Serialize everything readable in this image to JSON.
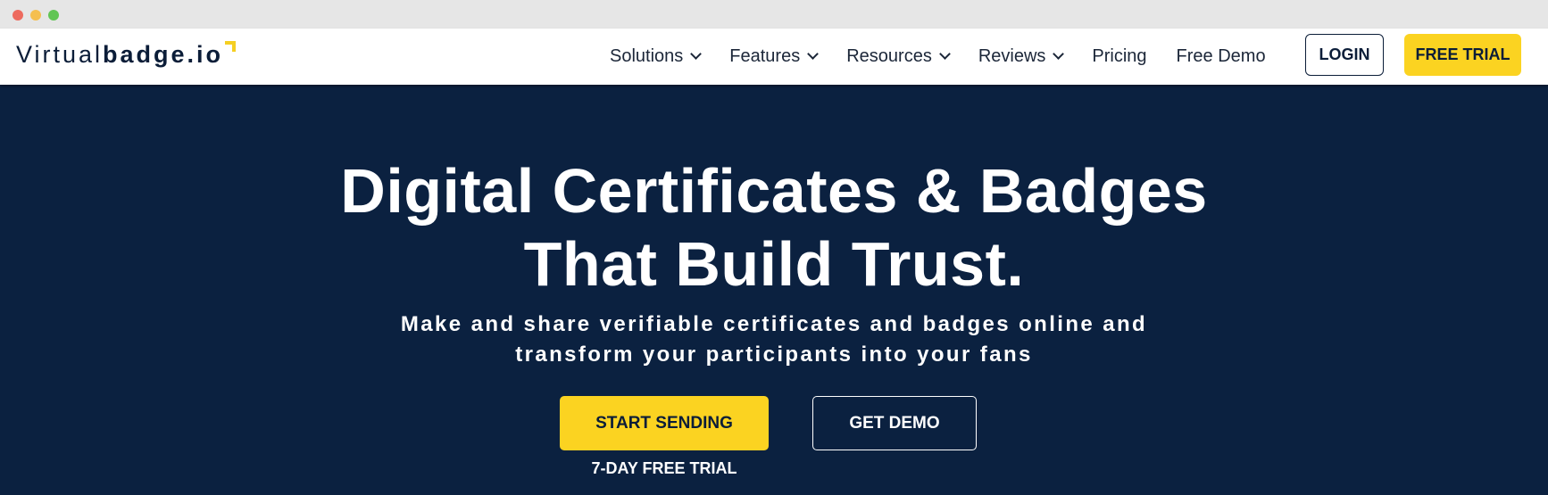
{
  "logo": {
    "light": "Virtual",
    "bold": "badge.io"
  },
  "nav": {
    "items": [
      {
        "label": "Solutions",
        "dropdown": true
      },
      {
        "label": "Features",
        "dropdown": true
      },
      {
        "label": "Resources",
        "dropdown": true
      },
      {
        "label": "Reviews",
        "dropdown": true
      },
      {
        "label": "Pricing",
        "dropdown": false
      },
      {
        "label": "Free Demo",
        "dropdown": false
      }
    ],
    "login_label": "LOGIN",
    "trial_label": "FREE TRIAL"
  },
  "hero": {
    "title_line1": "Digital Certificates & Badges",
    "title_line2": "That Build Trust.",
    "subtitle_line1": "Make and share verifiable certificates and badges online and",
    "subtitle_line2": "transform your participants into your fans",
    "primary_cta": "START SENDING",
    "secondary_cta": "GET DEMO",
    "trial_note": "7-DAY FREE TRIAL"
  },
  "colors": {
    "hero_bg": "#0b2140",
    "accent": "#fbd321",
    "navy": "#0b1d38"
  }
}
